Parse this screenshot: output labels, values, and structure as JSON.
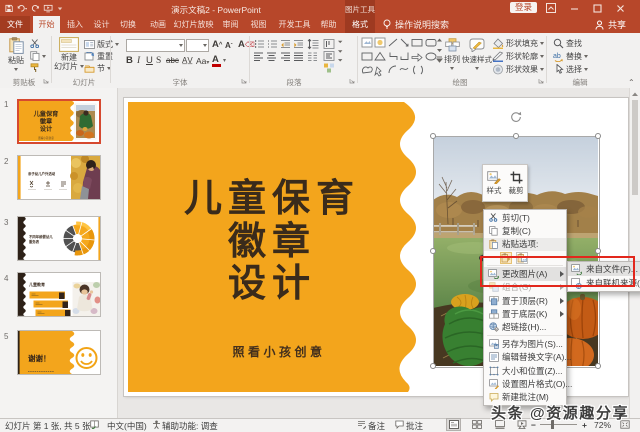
{
  "window": {
    "title": "演示文稿2 - PowerPoint",
    "contextual_tool": "图片工具",
    "signin_label": "登录",
    "share_label": "共享",
    "tellme_label": "操作说明搜索"
  },
  "tabs": {
    "file": "文件",
    "home": "开始",
    "insert": "插入",
    "design": "设计",
    "transitions": "切换",
    "animations": "动画",
    "slideshow": "幻灯片放映",
    "review": "审阅",
    "view": "视图",
    "developer": "开发工具",
    "help": "帮助",
    "format": "格式"
  },
  "ribbon": {
    "clipboard": {
      "label": "剪贴板",
      "paste": "粘贴"
    },
    "slides": {
      "label": "幻灯片",
      "new_slide_1": "新建",
      "new_slide_2": "幻灯片",
      "layout": "版式",
      "reset": "重置",
      "section": "节"
    },
    "font": {
      "label": "字体",
      "bold": "B",
      "italic": "I",
      "underline": "U",
      "strike": "S",
      "abc": "abc",
      "av": "AV",
      "aa": "Aa",
      "color": "A",
      "grow": "A",
      "clear": "A"
    },
    "paragraph": {
      "label": "段落"
    },
    "drawing": {
      "label": "绘图",
      "arrange": "排列",
      "quick_styles": "快速样式",
      "shape_fill": "形状填充",
      "shape_outline": "形状轮廓",
      "shape_effects": "形状效果"
    },
    "editing": {
      "label": "编辑",
      "find": "查找",
      "replace": "替换",
      "select": "选择"
    }
  },
  "slide_panel": {
    "numbers": [
      "1",
      "2",
      "3",
      "4",
      "5"
    ],
    "thumb1": {
      "line1": "儿童保育",
      "line2": "徽章",
      "line3": "设计",
      "subtitle": "照看小孩创意"
    },
    "thumb2": {
      "title": "亲子幼儿户外活动"
    },
    "thumb3": {
      "title1": "不同年龄婴幼儿",
      "title2": "服务表"
    },
    "thumb4": {
      "title": "儿童教育"
    },
    "thumb5": {
      "title": "谢谢！"
    }
  },
  "slide": {
    "title_line1": "儿童保育",
    "title_line2": "徽章",
    "title_line3": "设计",
    "subtitle": "照看小孩创意"
  },
  "mini_toolbar": {
    "style": "样式",
    "crop": "裁剪"
  },
  "context_menu": {
    "cut": "剪切(T)",
    "copy": "复制(C)",
    "paste_options": "粘贴选项:",
    "change_picture": "更改图片(A)",
    "group": "组合(G)",
    "bring_front": "置于顶层(R)",
    "send_back": "置于底层(K)",
    "hyperlink": "超链接(H)...",
    "save_as_picture": "另存为图片(S)...",
    "edit_alt_text": "编辑替换文字(A)...",
    "size_position": "大小和位置(Z)...",
    "format_picture": "设置图片格式(O)...",
    "new_comment": "新建批注(M)"
  },
  "submenu": {
    "from_file": "来自文件(F)...",
    "from_online": "来自联机来源(E)..."
  },
  "status_bar": {
    "slide_info": "幻灯片 第 1 张, 共 5 张",
    "language": "中文(中国)",
    "accessibility": "辅助功能: 调查",
    "notes": "备注",
    "comments": "批注",
    "zoom": "72%"
  },
  "watermark": "头条 @资源趣分享",
  "colors": {
    "brand_red": "#B7472A",
    "contextual_red": "#9E3A21",
    "accent_orange": "#F3A51C",
    "slide_text_brown": "#3A2B1B",
    "annotation_red": "#E2271C"
  }
}
